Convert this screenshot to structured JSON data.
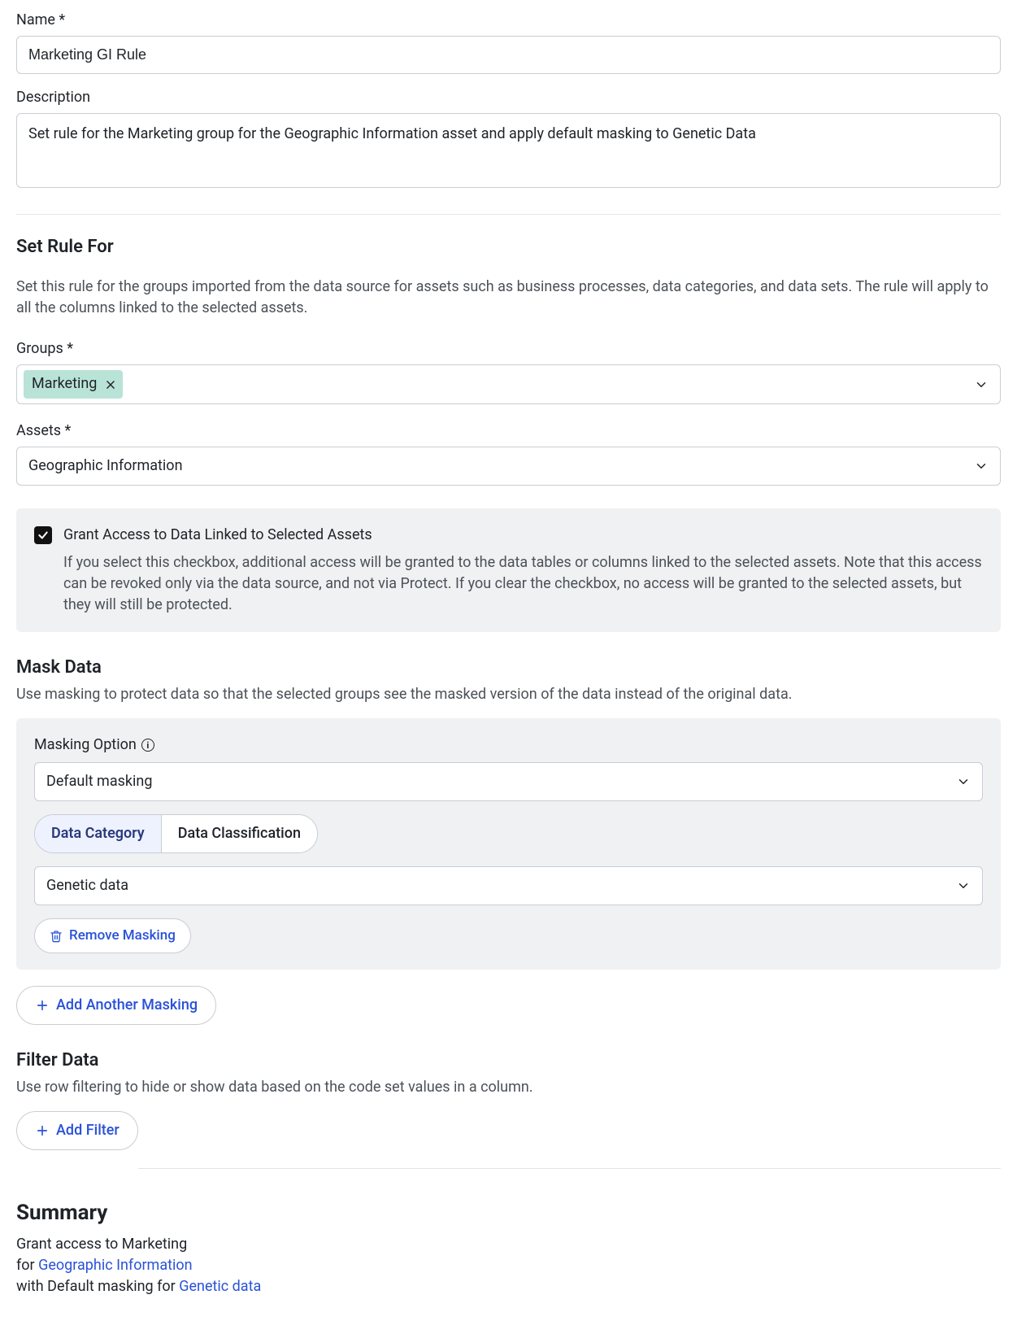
{
  "fields": {
    "name_label": "Name",
    "name_value": "Marketing GI Rule",
    "description_label": "Description",
    "description_value": "Set rule for the Marketing group for the Geographic Information asset and apply default masking to Genetic Data"
  },
  "setRuleFor": {
    "heading": "Set Rule For",
    "desc": "Set this rule for the groups imported from the data source for assets such as business processes, data categories, and data sets. The rule will apply to all the columns linked to the selected assets.",
    "groups_label": "Groups",
    "groups_chip": "Marketing",
    "assets_label": "Assets",
    "assets_value": "Geographic Information"
  },
  "grantAccess": {
    "checked": true,
    "title": "Grant Access to Data Linked to Selected Assets",
    "desc": "If you select this checkbox, additional access will be granted to the data tables or columns linked to the selected assets. Note that this access can be revoked only via the data source, and not via Protect. If you clear the checkbox, no access will be granted to the selected assets, but they will still be protected."
  },
  "maskData": {
    "heading": "Mask Data",
    "desc": "Use masking to protect data so that the selected groups see the masked version of the data instead of the original data.",
    "masking_option_label": "Masking Option",
    "masking_option_value": "Default masking",
    "segment_options": [
      "Data Category",
      "Data Classification"
    ],
    "segment_selected": 0,
    "category_value": "Genetic data",
    "remove_masking_label": "Remove Masking",
    "add_another_masking_label": "Add Another Masking"
  },
  "filterData": {
    "heading": "Filter Data",
    "desc": "Use row filtering to hide or show data based on the code set values in a column.",
    "add_filter_label": "Add Filter"
  },
  "summary": {
    "heading": "Summary",
    "line1_prefix": "Grant access to ",
    "line1_group": "Marketing",
    "line2_prefix": "for ",
    "line2_link": "Geographic Information",
    "line3_prefix": "with Default masking for ",
    "line3_link": "Genetic data"
  },
  "icons": {
    "chevron_down": "chevron-down",
    "close_x": "close",
    "info": "info",
    "plus": "plus",
    "trash": "trash",
    "check": "check"
  }
}
